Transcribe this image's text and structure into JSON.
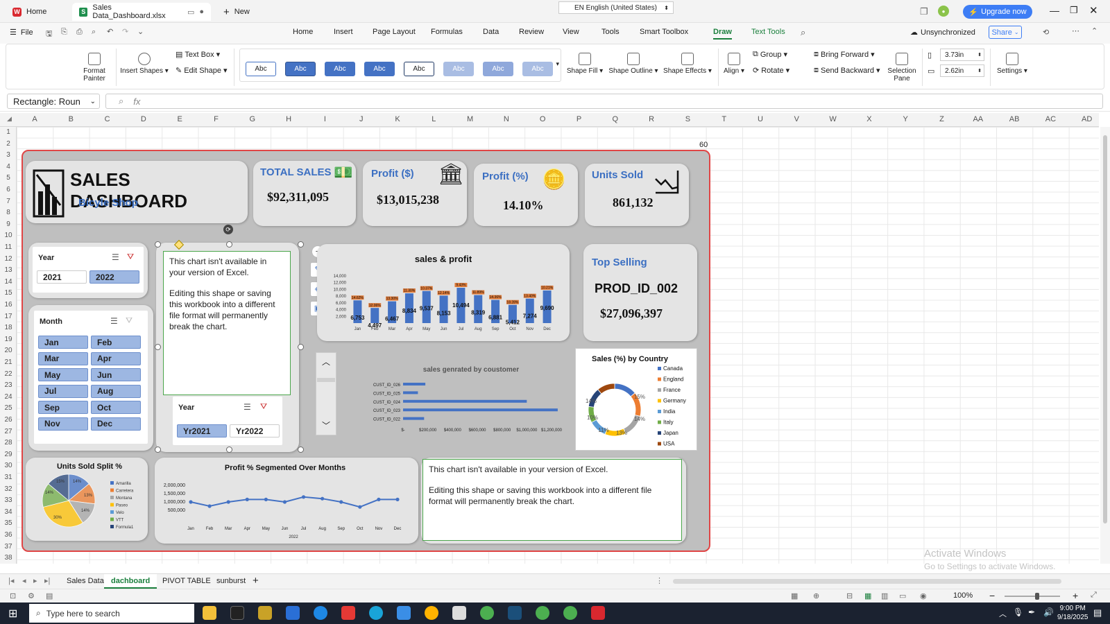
{
  "titlebar": {
    "home_tab": "Home",
    "file_tab": "Sales Data_Dashboard.xlsx",
    "new_tab": "New",
    "language": "EN English (United States)",
    "upgrade": "Upgrade now"
  },
  "menubar": {
    "file": "File",
    "items": [
      "Home",
      "Insert",
      "Page Layout",
      "Formulas",
      "Data",
      "Review",
      "View",
      "Tools",
      "Smart Toolbox",
      "Draw",
      "Text Tools"
    ],
    "sync": "Unsynchronized",
    "share": "Share"
  },
  "ribbon": {
    "format_painter": "Format Painter",
    "insert_shapes": "Insert Shapes",
    "text_box": "Text Box",
    "edit_shape": "Edit Shape",
    "styles": [
      "Abc",
      "Abc",
      "Abc",
      "Abc",
      "Abc",
      "Abc",
      "Abc",
      "Abc"
    ],
    "shape_fill": "Shape Fill",
    "shape_outline": "Shape Outline",
    "shape_effects": "Shape Effects",
    "align": "Align",
    "group": "Group",
    "rotate": "Rotate",
    "bring_forward": "Bring Forward",
    "send_backward": "Send Backward",
    "selection_pane": "Selection Pane",
    "height": "3.73in",
    "width": "2.62in",
    "settings": "Settings"
  },
  "formula_bar": {
    "name_box": "Rectangle: Roun",
    "fx": "fx"
  },
  "grid": {
    "columns": [
      "A",
      "B",
      "C",
      "D",
      "E",
      "F",
      "G",
      "H",
      "I",
      "J",
      "K",
      "L",
      "M",
      "N",
      "O",
      "P",
      "Q",
      "R",
      "S",
      "T",
      "U",
      "V",
      "W",
      "X",
      "Y",
      "Z",
      "AA",
      "AB",
      "AC",
      "AD"
    ],
    "rows": [
      "1",
      "2",
      "3",
      "4",
      "5",
      "6",
      "7",
      "8",
      "9",
      "10",
      "11",
      "12",
      "13",
      "14",
      "15",
      "16",
      "17",
      "18",
      "19",
      "20",
      "21",
      "22",
      "23",
      "24",
      "25",
      "26",
      "27",
      "28",
      "29",
      "30",
      "31",
      "32",
      "33",
      "34",
      "35",
      "36",
      "37",
      "38"
    ],
    "s2_value": "60"
  },
  "dashboard": {
    "title": "SALES DASHBOARD",
    "subtitle": "Bicyle Shop",
    "kpis": [
      {
        "label": "TOTAL SALES",
        "value": "$92,311,095"
      },
      {
        "label": "Profit ($)",
        "value": "$13,015,238"
      },
      {
        "label": "Profit (%)",
        "value": "14.10%"
      },
      {
        "label": "Units Sold",
        "value": "861,132"
      }
    ],
    "year_slicer": {
      "title": "Year",
      "options": [
        "2021",
        "2022"
      ],
      "selected": "2022"
    },
    "month_slicer": {
      "title": "Month",
      "options": [
        "Jan",
        "Feb",
        "Mar",
        "Apr",
        "May",
        "Jun",
        "Jul",
        "Aug",
        "Sep",
        "Oct",
        "Nov",
        "Dec"
      ]
    },
    "year2_slicer": {
      "title": "Year",
      "options": [
        "Yr2021",
        "Yr2022"
      ],
      "selected": "Yr2021"
    },
    "placeholder_1": [
      "This chart isn't available in your version of Excel.",
      "Editing this shape or saving this workbook into a different file format will permanently break the chart."
    ],
    "placeholder_2": [
      "This chart isn't available in your version of Excel.",
      "Editing this shape or saving this workbook into a different file format will permanently break the chart."
    ],
    "top_selling": {
      "title": "Top Selling",
      "product": "PROD_ID_002",
      "value": "$27,096,397"
    }
  },
  "chart_data": [
    {
      "type": "bar",
      "title": "sales & profit",
      "categories": [
        "Jan",
        "Feb",
        "Mar",
        "Apr",
        "May",
        "Jun",
        "Jul",
        "Aug",
        "Sep",
        "Oct",
        "Nov",
        "Dec"
      ],
      "series": [
        {
          "values": [
            6753,
            4497,
            6467,
            8834,
            9537,
            8153,
            10494,
            8319,
            6881,
            5412,
            7274,
            9690
          ]
        }
      ],
      "labels": [
        "6,753",
        "4,497",
        "6,467",
        "8,834",
        "9,537",
        "8,153",
        "10,494",
        "8,319",
        "6,881",
        "5,412",
        "7,274",
        "9,690"
      ],
      "profit_labels": [
        "14.62%",
        "12.06%",
        "13.30%",
        "11.30%",
        "10.37%",
        "12.14%",
        "9.43%",
        "11.89%",
        "14.36%",
        "18.28%",
        "13.40%",
        "10.21%"
      ],
      "yticks": [
        "2,000",
        "4,000",
        "6,000",
        "8,000",
        "10,000",
        "12,000",
        "14,000"
      ],
      "ylim": [
        0,
        14000
      ],
      "colors": {
        "bar": "#4472c4",
        "label_bg": "#e07b39"
      }
    },
    {
      "type": "bar",
      "title": "sales genrated by coustomer",
      "categories": [
        "CUST_ID_026",
        "CUST_ID_025",
        "CUST_ID_024",
        "CUST_ID_023",
        "CUST_ID_022"
      ],
      "values": [
        180000,
        120000,
        1000000,
        1250000,
        170000
      ],
      "xticks": [
        "$-",
        "$200,000",
        "$400,000",
        "$600,000",
        "$800,000",
        "$1,000,000",
        "$1,200,000"
      ],
      "xlim": [
        0,
        1200000
      ],
      "orientation": "horizontal"
    },
    {
      "type": "pie",
      "title": "Sales (%) by    Country",
      "legend": [
        "Canada",
        "England",
        "France",
        "Germany",
        "India",
        "Italy",
        "Japan",
        "USA"
      ],
      "colors": [
        "#4472c4",
        "#ed7d31",
        "#a5a5a5",
        "#ffc000",
        "#5b9bd5",
        "#70ad47",
        "#264478",
        "#9e480e"
      ],
      "values": [
        14,
        15,
        14,
        13,
        11,
        10,
        12,
        11
      ],
      "labels": [
        "15%",
        "14%",
        "13%",
        "11%",
        "10%",
        "14%"
      ]
    },
    {
      "type": "pie",
      "title": "Units Sold Split %",
      "legend": [
        "Amarilla",
        "Carretera",
        "Montana",
        "Paseo",
        "Velo",
        "VTT",
        "Formula1"
      ],
      "colors": [
        "#4472c4",
        "#ed7d31",
        "#a5a5a5",
        "#ffc000",
        "#5b9bd5",
        "#70ad47",
        "#264478"
      ],
      "values": [
        14,
        13,
        14,
        30,
        0,
        15,
        14
      ],
      "labels": [
        "14%",
        "13%",
        "14%",
        "30%",
        "14%",
        "15%"
      ]
    },
    {
      "type": "line",
      "title": "Profit % Segmented Over Months",
      "categories": [
        "Jan",
        "Feb",
        "Mar",
        "Apr",
        "May",
        "Jun",
        "Jul",
        "Aug",
        "Sep",
        "Oct",
        "Nov",
        "Dec"
      ],
      "values": [
        1000000,
        750000,
        1000000,
        1150000,
        1150000,
        1000000,
        1300000,
        1200000,
        1000000,
        700000,
        1150000,
        1150000
      ],
      "yticks": [
        "500,000",
        "1,000,000",
        "1,500,000",
        "2,000,000"
      ],
      "ylim": [
        0,
        2000000
      ],
      "xlabel": "2022"
    }
  ],
  "sheet_tabs": [
    "Sales Data",
    "dachboard",
    "PIVOT TABLE",
    "sunburst"
  ],
  "active_sheet": "dachboard",
  "status": {
    "zoom": "100%"
  },
  "watermark": {
    "line1": "Activate Windows",
    "line2": "Go to Settings to activate Windows."
  },
  "taskbar": {
    "search": "Type here to search",
    "time": "9:00 PM",
    "date": "9/18/2025"
  }
}
